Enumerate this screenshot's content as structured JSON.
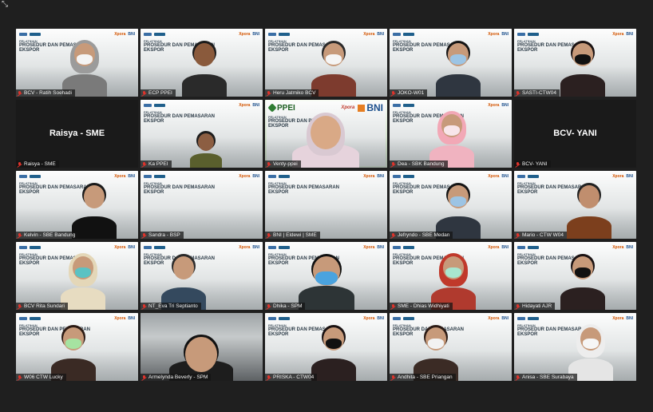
{
  "window": {
    "corner_icon": "restore-icon"
  },
  "tiles": [
    {
      "name": "BCV - Ratih Soehadi",
      "kind": "slide",
      "person": "hijab-mask"
    },
    {
      "name": "ECP PPEI",
      "kind": "slide",
      "person": "man-dark"
    },
    {
      "name": "Heru Jatmiko BCV",
      "kind": "slide",
      "person": "man-mask-white"
    },
    {
      "name": "JOKO-W01",
      "kind": "slide",
      "person": "man-mask-blue"
    },
    {
      "name": "SASTI-CTW04",
      "kind": "slide",
      "person": "woman-mask-black"
    },
    {
      "name": "Raisya - SME",
      "kind": "name-only",
      "label": "Raisya - SME"
    },
    {
      "name": "Ka PPEI",
      "kind": "slide",
      "person": "man-small"
    },
    {
      "name": "Venty-ppei",
      "kind": "active",
      "person": "hijab-glasses",
      "slide": {
        "ppei": "PPEI",
        "xpora": "Xpora",
        "bni": "BNI"
      }
    },
    {
      "name": "Dea - SBK Bandung",
      "kind": "slide",
      "person": "hijab-pink"
    },
    {
      "name": "BCV- YANI",
      "kind": "name-only",
      "label": "BCV- YANI"
    },
    {
      "name": "Kelvin - SBE Bandung",
      "kind": "slide",
      "person": "man-cap"
    },
    {
      "name": "Sandra - BSP",
      "kind": "slide",
      "person": "none"
    },
    {
      "name": "BNI | Eldewi | SME",
      "kind": "slide",
      "person": "none"
    },
    {
      "name": "Jefryndo - SBE Medan",
      "kind": "slide",
      "person": "man-mask-blue"
    },
    {
      "name": "Mario - CTW W04",
      "kind": "slide",
      "person": "man-batik"
    },
    {
      "name": "BCV Rita Sundari",
      "kind": "slide",
      "person": "hijab-mask-teal"
    },
    {
      "name": "NT_Eva Tri Septianto",
      "kind": "slide",
      "person": "man-glasses"
    },
    {
      "name": "Dhika - SPM",
      "kind": "slide",
      "person": "man-mask-blue-big"
    },
    {
      "name": "SME - Dhias Widhiyati",
      "kind": "slide",
      "person": "hijab-red-mask"
    },
    {
      "name": "Hidayati AJR",
      "kind": "slide",
      "person": "woman-mask-black"
    },
    {
      "name": "W06 CTW Lucky",
      "kind": "slide",
      "person": "woman-mask-green"
    },
    {
      "name": "Armelynda Beverly - SPM",
      "kind": "webcam",
      "person": "woman-back"
    },
    {
      "name": "PRISKA - CTW04",
      "kind": "slide",
      "person": "woman-mask-black"
    },
    {
      "name": "Andhita - SBE Priangan",
      "kind": "slide",
      "person": "woman-mask-white"
    },
    {
      "name": "Anisa - SBE Surabaya",
      "kind": "slide-bni",
      "person": "hijab-mask-white"
    }
  ],
  "slide": {
    "line1": "PELATIHAN",
    "line2": "PROSEDUR DAN PEMASARAN",
    "line3": "EKSPOR",
    "brand_right": "Xpora",
    "brand_bni": "BNI"
  },
  "colors": {
    "active_outline": "#7fd13b",
    "mic_muted": "#e0332b",
    "background": "#1f1f1f"
  }
}
